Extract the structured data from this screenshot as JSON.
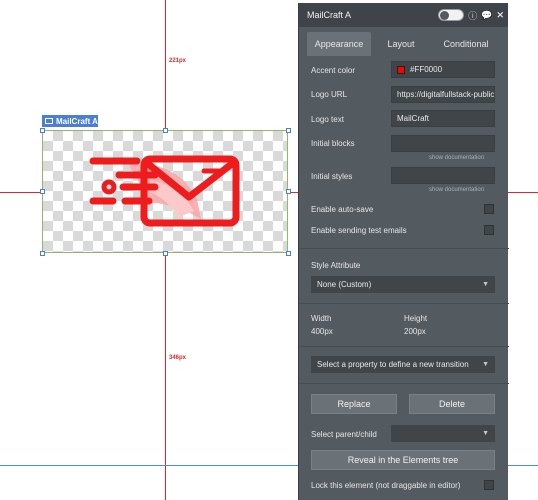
{
  "canvas": {
    "top_distance_label": "221px",
    "bottom_distance_label": "346px",
    "element_tag_label": "MailCraft A"
  },
  "panel": {
    "title": "MailCraft A",
    "tabs": [
      {
        "label": "Appearance"
      },
      {
        "label": "Layout"
      },
      {
        "label": "Conditional"
      }
    ],
    "accent_color": {
      "label": "Accent color",
      "value": "#FF0000",
      "swatch": "#ff0000"
    },
    "logo_url": {
      "label": "Logo URL",
      "value": "https://digitalfullstack-public"
    },
    "logo_text": {
      "label": "Logo text",
      "value": "MailCraft"
    },
    "initial_blocks": {
      "label": "Initial blocks",
      "doc_link": "show documentation"
    },
    "initial_styles": {
      "label": "Initial styles",
      "doc_link": "show documentation"
    },
    "enable_autosave": {
      "label": "Enable auto-save"
    },
    "enable_test_emails": {
      "label": "Enable sending test emails"
    },
    "style_attribute": {
      "label": "Style Attribute",
      "value": "None (Custom)"
    },
    "width": {
      "label": "Width",
      "value": "400px"
    },
    "height": {
      "label": "Height",
      "value": "200px"
    },
    "transition": {
      "placeholder": "Select a property to define a new transition"
    },
    "replace_label": "Replace",
    "delete_label": "Delete",
    "select_parent": {
      "label": "Select parent/child"
    },
    "reveal_label": "Reveal in the Elements tree",
    "lock_label": "Lock this element (not draggable in editor)"
  },
  "colors": {
    "accent": "#ff0000",
    "panel_bg": "#535a60",
    "guide": "#e8222a",
    "selection": "#4a7fd4"
  },
  "icons": [
    "envelope-icon",
    "info-icon",
    "comment-icon",
    "close-icon",
    "chevron-down-icon"
  ]
}
